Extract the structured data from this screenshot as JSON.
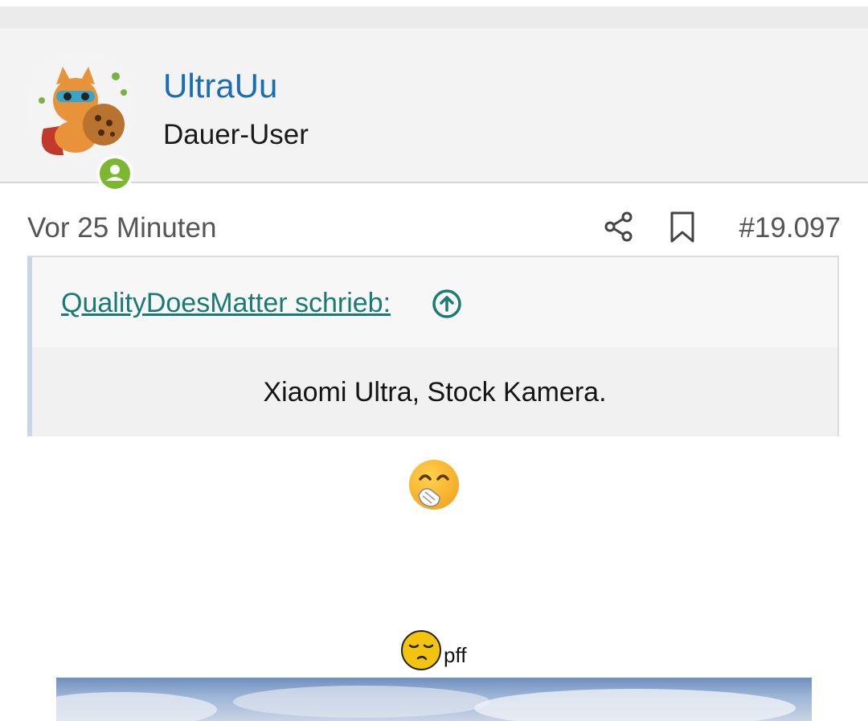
{
  "post": {
    "author": {
      "username": "UltraUu",
      "title": "Dauer-User",
      "avatar_icon": "cat-hero-cookie-avatar",
      "status_icon": "online-user-icon",
      "status_color": "#7cb82f"
    },
    "meta": {
      "time": "Vor 25 Minuten",
      "share_icon": "share-icon",
      "bookmark_icon": "bookmark-icon",
      "post_number": "#19.097"
    },
    "quote": {
      "attribution": "QualityDoesMatter schrieb:",
      "text": "Xiaomi Ultra, Stock Kamera."
    },
    "body": {
      "emoji_1": "face-with-hand-over-mouth-emoji",
      "emoji_2": "smug-face-emoji",
      "text": "pff"
    }
  },
  "colors": {
    "link": "#1a6db3",
    "quote_link": "#1b7a73",
    "header_bg": "#f3f3f3"
  }
}
